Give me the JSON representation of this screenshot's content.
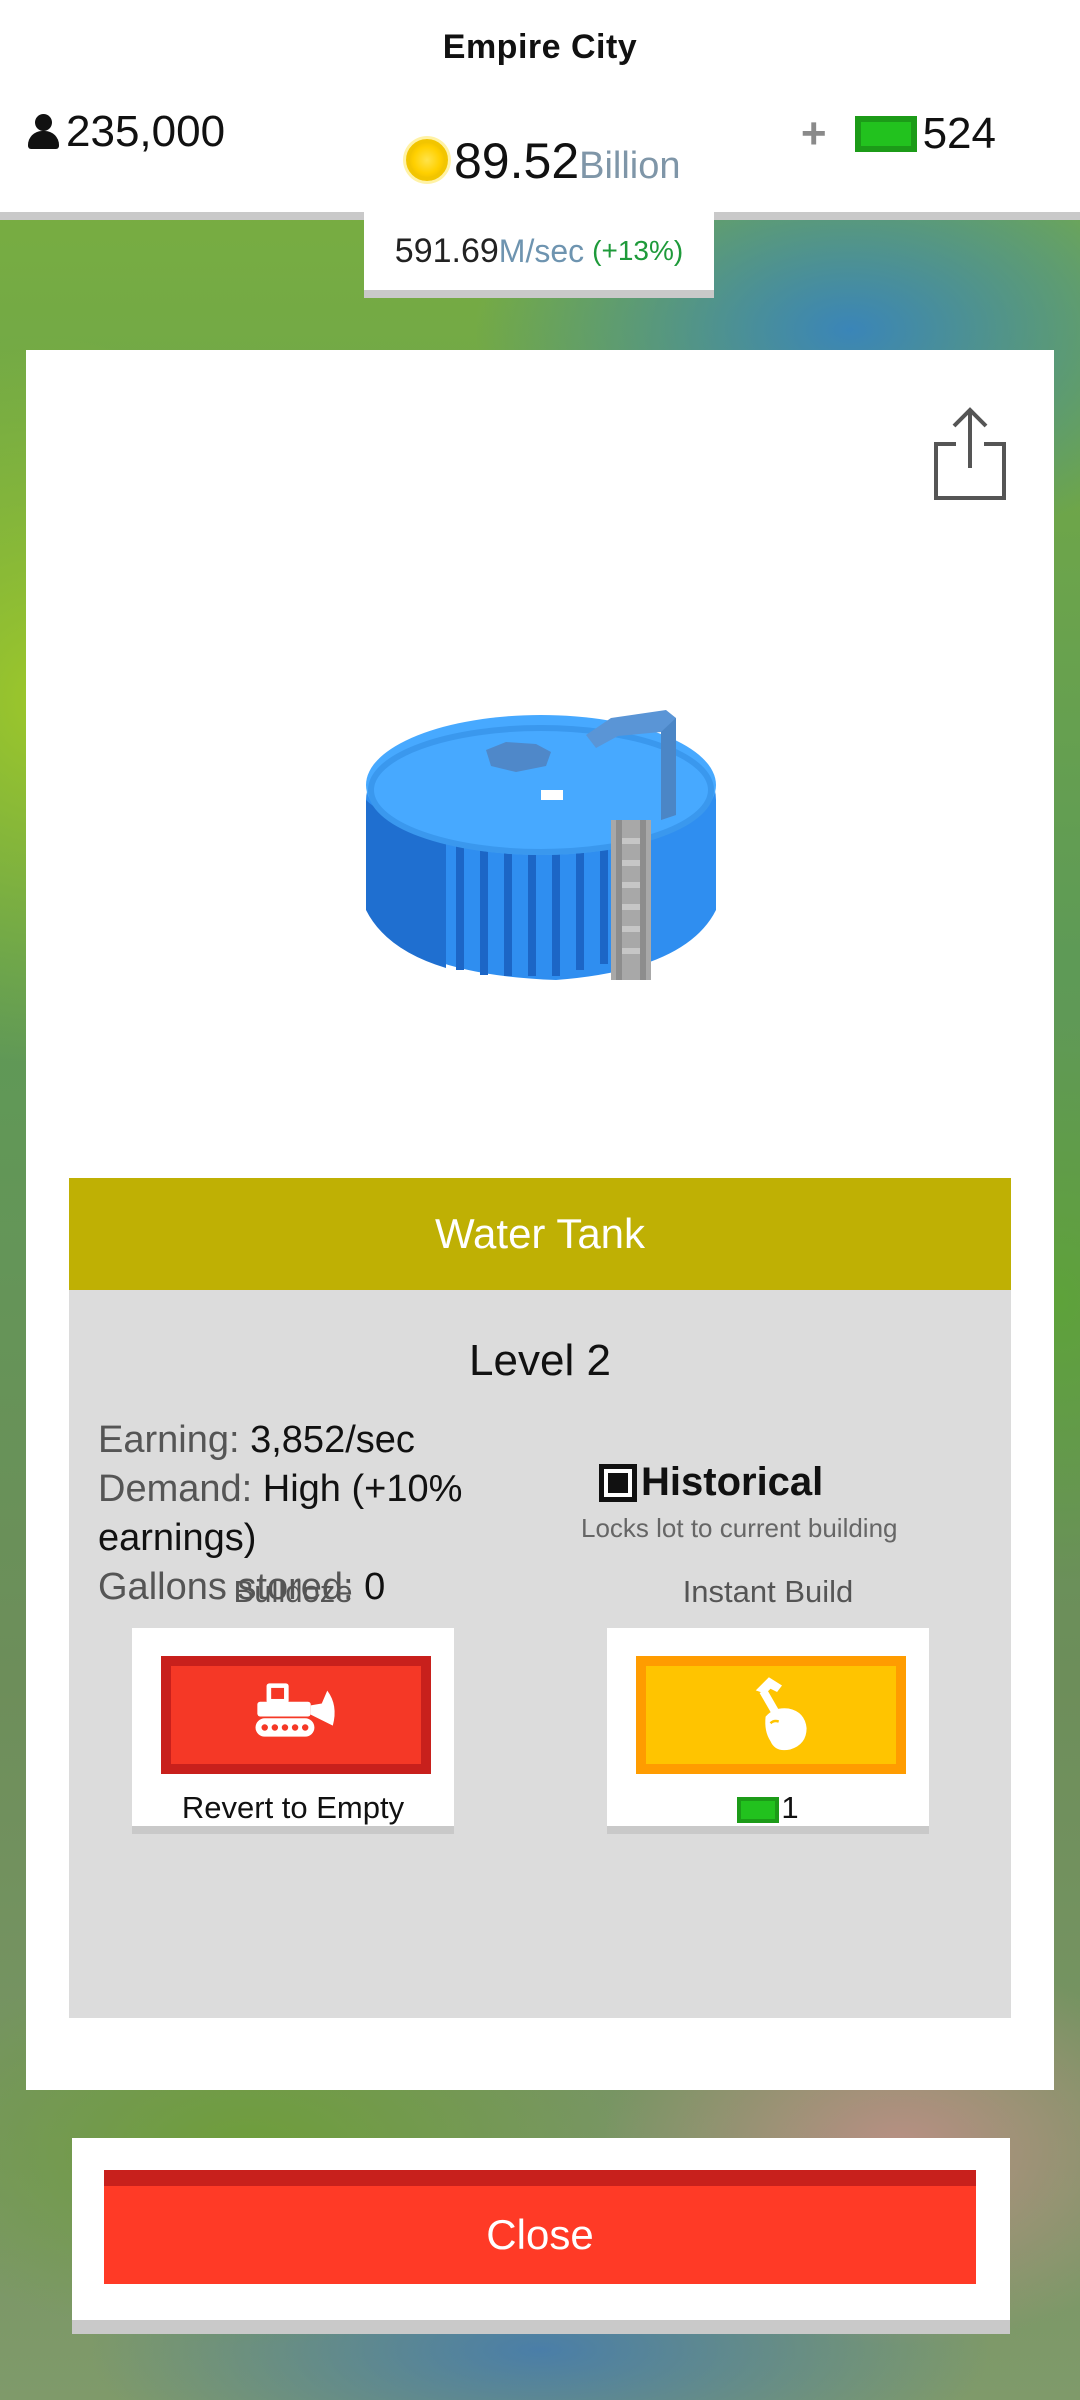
{
  "header": {
    "city_name": "Empire City",
    "population": "235,000",
    "cash_value": "89.52",
    "cash_unit": "Billion",
    "bucks_plus": "+",
    "bucks_value": "524",
    "rate_value": "591.69",
    "rate_unit": "M/sec",
    "rate_bonus": "(+13%)"
  },
  "building": {
    "name": "Water Tank",
    "level": "Level 2",
    "stats": {
      "earning_label": "Earning:",
      "earning_value": "3,852/sec",
      "demand_label": "Demand:",
      "demand_value": "High (+10% earnings)",
      "gallons_label": "Gallons stored:",
      "gallons_value": "0"
    },
    "historical": {
      "title": "Historical",
      "subtitle": "Locks lot to current building"
    }
  },
  "actions": {
    "bulldoze_label": "Bulldoze",
    "bulldoze_caption": "Revert to Empty",
    "instant_label": "Instant Build",
    "instant_cost": "1"
  },
  "close_label": "Close",
  "colors": {
    "title_bar": "#bfb004",
    "bulldoze": "#f53826",
    "instant_build": "#ffc400",
    "close": "#ff3a26",
    "bonus_green": "#1e9a3a",
    "tank_blue": "#2f8ef0"
  },
  "icons": {
    "population": "person-icon",
    "cash": "coin-icon",
    "bucks": "cash-icon",
    "share": "share-icon",
    "bulldoze": "bulldozer-icon",
    "instant": "hammer-hand-icon",
    "historical": "checkbox-icon"
  }
}
